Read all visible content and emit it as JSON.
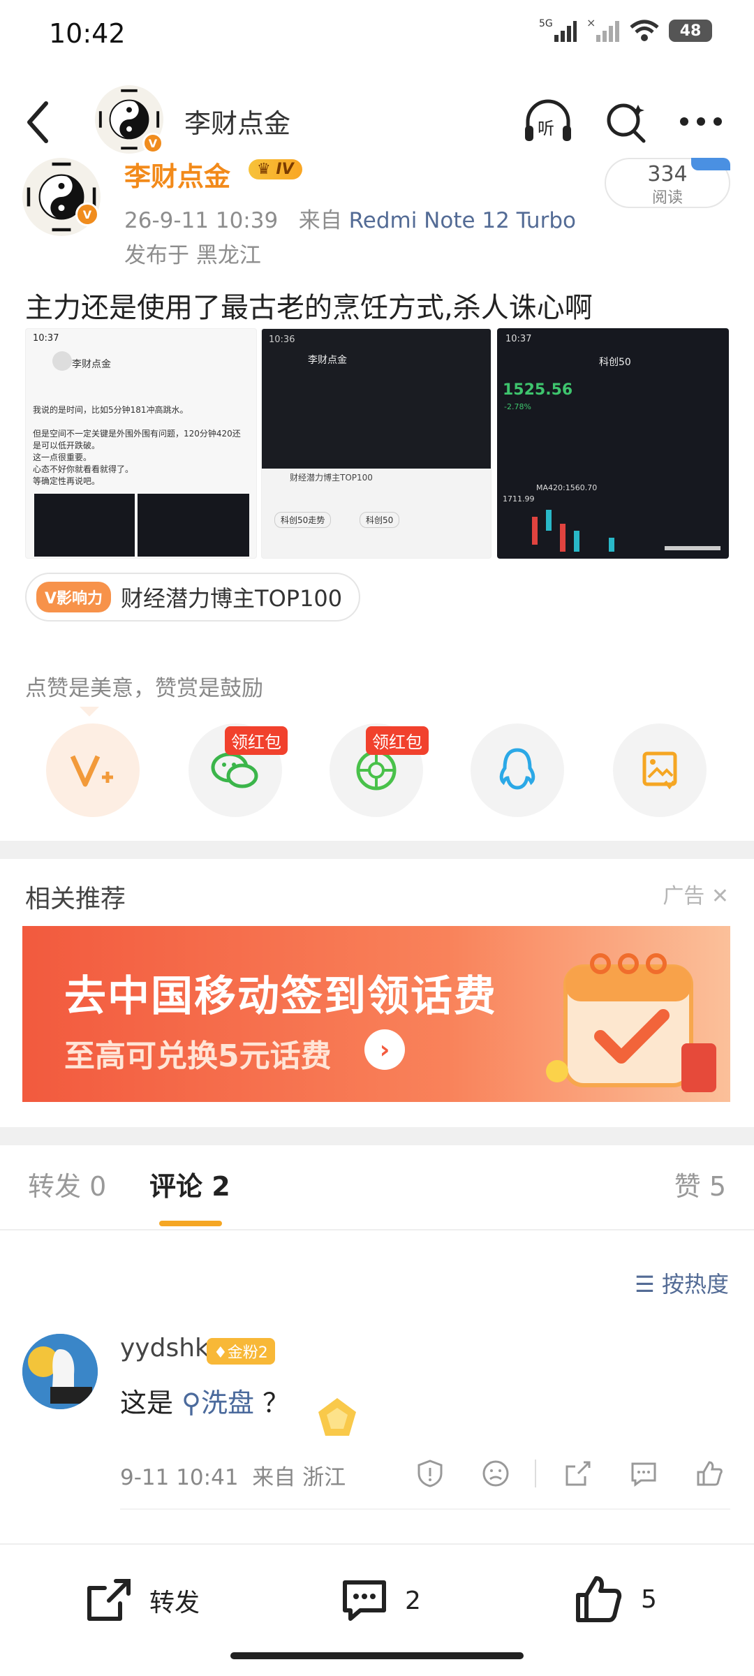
{
  "status_bar": {
    "time": "10:42",
    "battery": "48"
  },
  "nav": {
    "title": "李财点金"
  },
  "post": {
    "author": "李财点金",
    "level": "IV",
    "datetime": "26-9-11 10:39",
    "from_label": "来自",
    "device": "Redmi Note 12 Turbo",
    "location": "发布于 黑龙江",
    "read_count": "334",
    "read_label": "阅读",
    "text": "主力还是使用了最古老的烹饪方式,杀人诛心啊"
  },
  "thumbnails": [
    {
      "time": "10:37",
      "name": "李财点金",
      "lines": [
        "我说的是时间，比如5分钟181冲高跳水。",
        "但是空间不一定关键是外围外围有问题，120分钟420还",
        "是可以低开跌破。",
        "这一点很重要。",
        "心态不好你就看看就得了。",
        "等确定性再说吧。"
      ]
    },
    {
      "time": "10:36",
      "name": "李财点金",
      "caption": "财经潜力博主TOP100",
      "chips": [
        "科创50走势",
        "科创50"
      ]
    },
    {
      "time": "10:37",
      "title": "科创50",
      "price": "1525.56",
      "change": "-2.78%",
      "ma": "MA420:1560.70",
      "note": "1711.99"
    }
  ],
  "influence": {
    "tag": "V影响力",
    "text": "财经潜力博主TOP100"
  },
  "praise_text": "点赞是美意，赞赏是鼓励",
  "red_packet_label": "领红包",
  "related": {
    "title": "相关推荐",
    "ad_label": "广告"
  },
  "ad": {
    "line1": "去中国移动签到领话费",
    "line2": "至高可兑换5元话费"
  },
  "tabs": [
    {
      "label": "转发",
      "count": "0"
    },
    {
      "label": "评论",
      "count": "2"
    },
    {
      "label": "赞",
      "count": "5"
    }
  ],
  "sort_label": "按热度",
  "comment": {
    "user": "yydshk",
    "badge": "金粉2",
    "text_prefix": "这是",
    "link": "洗盘",
    "text_suffix": "？",
    "time": "9-11 10:41",
    "from": "来自 浙江"
  },
  "bottom": {
    "repost": "转发",
    "comments": "2",
    "likes": "5"
  },
  "colors": {
    "accent": "#f28a1a",
    "link": "#536b95",
    "red": "#f1412d"
  }
}
